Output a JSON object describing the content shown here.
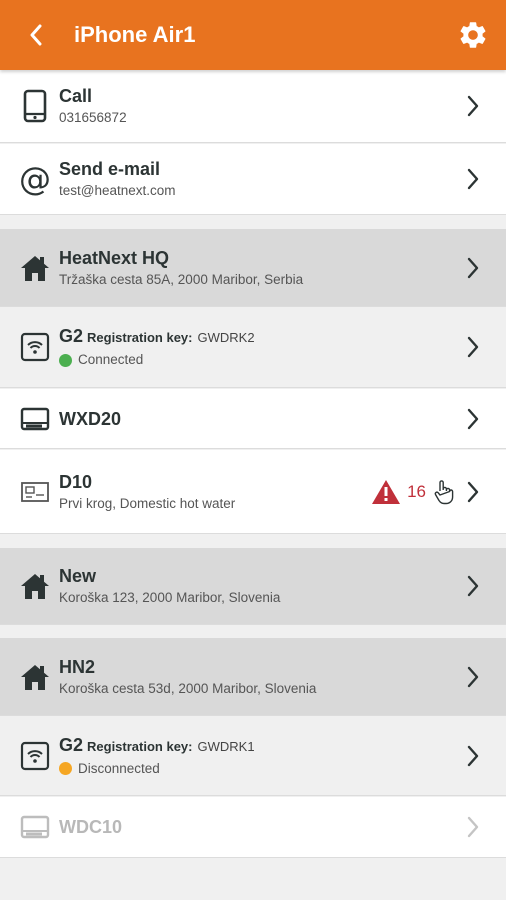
{
  "header": {
    "title": "iPhone Air1",
    "back_icon": "chevron-left-icon",
    "settings_icon": "gear-icon"
  },
  "colors": {
    "accent": "#e8731f",
    "connected": "#4caf50",
    "disconnected": "#f5a623",
    "alarm": "#c0303a"
  },
  "contact": {
    "call": {
      "label": "Call",
      "value": "031656872"
    },
    "email": {
      "label": "Send e-mail",
      "value": "test@heatnext.com"
    }
  },
  "items": [
    {
      "name": "HeatNext HQ",
      "sub": "Tržaška cesta 85A, 2000 Maribor, Serbia"
    },
    {
      "name": "G2",
      "regkey_label": "Registration key:",
      "regkey": "GWDRK2",
      "status": "Connected"
    },
    {
      "name": "WXD20"
    },
    {
      "name": "D10",
      "sub": "Prvi krog, Domestic hot water",
      "alarm_count": "16"
    },
    {
      "name": "New",
      "sub": "Koroška 123, 2000 Maribor, Slovenia"
    },
    {
      "name": "HN2",
      "sub": "Koroška cesta 53d, 2000 Maribor, Slovenia"
    },
    {
      "name": "G2",
      "regkey_label": "Registration key:",
      "regkey": "GWDRK1",
      "status": "Disconnected"
    },
    {
      "name": "WDC10"
    }
  ]
}
